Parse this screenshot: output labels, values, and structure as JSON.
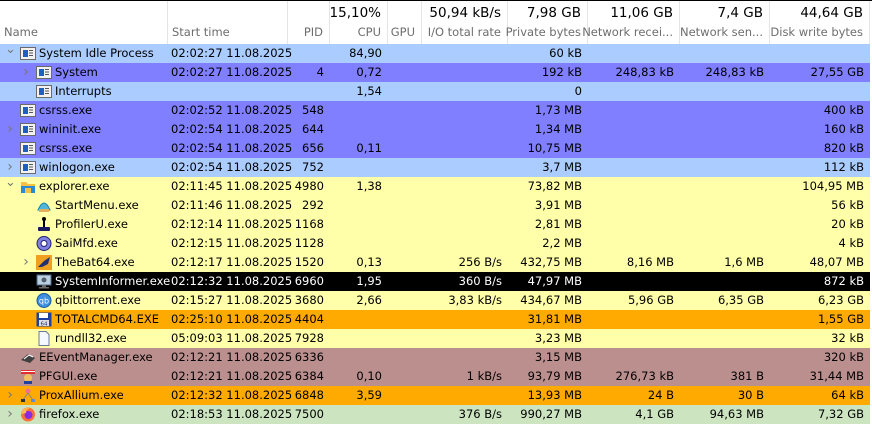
{
  "columns": [
    {
      "key": "name",
      "label": "Name",
      "total": ""
    },
    {
      "key": "start",
      "label": "Start time",
      "total": ""
    },
    {
      "key": "pid",
      "label": "PID",
      "total": ""
    },
    {
      "key": "cpu",
      "label": "CPU",
      "total": "15,10%"
    },
    {
      "key": "gpu",
      "label": "GPU",
      "total": ""
    },
    {
      "key": "io",
      "label": "I/O total rate",
      "total": "50,94 kB/s"
    },
    {
      "key": "priv",
      "label": "Private bytes",
      "total": "7,98 GB"
    },
    {
      "key": "nrecv",
      "label": "Network recei...",
      "total": "11,06 GB"
    },
    {
      "key": "nsent",
      "label": "Network sen...",
      "total": "7,4 GB"
    },
    {
      "key": "dwrite",
      "label": "Disk write bytes",
      "total": "44,64 GB"
    }
  ],
  "colors": {
    "system": "#aaccff",
    "service": "#7f7fff",
    "user": "#ffffaa",
    "elevated": "#ffaa00",
    "other_user": "#bc8f8f",
    "job": "#cce5c0",
    "selected": "#000000"
  },
  "processes": [
    {
      "name": "System Idle Process",
      "icon": "window-icon",
      "level": 0,
      "expander": "expanded",
      "color": "system",
      "start": "02:02:27 11.08.2025",
      "pid": "",
      "cpu": "84,90",
      "gpu": "",
      "io": "",
      "priv": "60 kB",
      "nrecv": "",
      "nsent": "",
      "dwrite": ""
    },
    {
      "name": "System",
      "icon": "window-icon",
      "level": 1,
      "expander": "collapsed",
      "color": "service",
      "start": "02:02:27 11.08.2025",
      "pid": "4",
      "cpu": "0,72",
      "gpu": "",
      "io": "",
      "priv": "192 kB",
      "nrecv": "248,83 kB",
      "nsent": "248,83 kB",
      "dwrite": "27,55 GB"
    },
    {
      "name": "Interrupts",
      "icon": "window-icon",
      "level": 1,
      "expander": "",
      "color": "system",
      "start": "",
      "pid": "",
      "cpu": "1,54",
      "gpu": "",
      "io": "",
      "priv": "0",
      "nrecv": "",
      "nsent": "",
      "dwrite": ""
    },
    {
      "name": "csrss.exe",
      "icon": "window-icon",
      "level": 0,
      "expander": "",
      "color": "service",
      "start": "02:02:52 11.08.2025",
      "pid": "548",
      "cpu": "",
      "gpu": "",
      "io": "",
      "priv": "1,73 MB",
      "nrecv": "",
      "nsent": "",
      "dwrite": "400 kB"
    },
    {
      "name": "wininit.exe",
      "icon": "window-icon",
      "level": 0,
      "expander": "collapsed",
      "color": "service",
      "start": "02:02:54 11.08.2025",
      "pid": "644",
      "cpu": "",
      "gpu": "",
      "io": "",
      "priv": "1,34 MB",
      "nrecv": "",
      "nsent": "",
      "dwrite": "160 kB"
    },
    {
      "name": "csrss.exe",
      "icon": "window-icon",
      "level": 0,
      "expander": "",
      "color": "service",
      "start": "02:02:54 11.08.2025",
      "pid": "656",
      "cpu": "0,11",
      "gpu": "",
      "io": "",
      "priv": "10,75 MB",
      "nrecv": "",
      "nsent": "",
      "dwrite": "820 kB"
    },
    {
      "name": "winlogon.exe",
      "icon": "window-icon",
      "level": 0,
      "expander": "collapsed",
      "color": "system",
      "start": "02:02:54 11.08.2025",
      "pid": "752",
      "cpu": "",
      "gpu": "",
      "io": "",
      "priv": "3,7 MB",
      "nrecv": "",
      "nsent": "",
      "dwrite": "112 kB"
    },
    {
      "name": "explorer.exe",
      "icon": "folder-icon",
      "level": 0,
      "expander": "expanded",
      "color": "user",
      "start": "02:11:45 11.08.2025",
      "pid": "4980",
      "cpu": "1,38",
      "gpu": "",
      "io": "",
      "priv": "73,82 MB",
      "nrecv": "",
      "nsent": "",
      "dwrite": "104,95 MB"
    },
    {
      "name": "StartMenu.exe",
      "icon": "shell-icon",
      "level": 1,
      "expander": "",
      "color": "user",
      "start": "02:11:46 11.08.2025",
      "pid": "292",
      "cpu": "",
      "gpu": "",
      "io": "",
      "priv": "3,91 MB",
      "nrecv": "",
      "nsent": "",
      "dwrite": "56 kB"
    },
    {
      "name": "ProfilerU.exe",
      "icon": "joystick-icon",
      "level": 1,
      "expander": "",
      "color": "user",
      "start": "02:12:14 11.08.2025",
      "pid": "1168",
      "cpu": "",
      "gpu": "",
      "io": "",
      "priv": "2,81 MB",
      "nrecv": "",
      "nsent": "",
      "dwrite": "20 kB"
    },
    {
      "name": "SaiMfd.exe",
      "icon": "gear-icon",
      "level": 1,
      "expander": "",
      "color": "user",
      "start": "02:12:15 11.08.2025",
      "pid": "1128",
      "cpu": "",
      "gpu": "",
      "io": "",
      "priv": "2,2 MB",
      "nrecv": "",
      "nsent": "",
      "dwrite": "4 kB"
    },
    {
      "name": "TheBat64.exe",
      "icon": "bat-icon",
      "level": 1,
      "expander": "collapsed",
      "color": "user",
      "start": "02:12:17 11.08.2025",
      "pid": "1520",
      "cpu": "0,13",
      "gpu": "",
      "io": "256 B/s",
      "priv": "432,75 MB",
      "nrecv": "8,16 MB",
      "nsent": "1,6 MB",
      "dwrite": "48,07 MB"
    },
    {
      "name": "SystemInformer.exe",
      "icon": "monitor-icon",
      "level": 1,
      "expander": "",
      "color": "selected",
      "selected": true,
      "start": "02:12:32 11.08.2025",
      "pid": "6960",
      "cpu": "1,95",
      "gpu": "",
      "io": "360 B/s",
      "priv": "47,97 MB",
      "nrecv": "",
      "nsent": "",
      "dwrite": "872 kB"
    },
    {
      "name": "qbittorrent.exe",
      "icon": "qbittorrent-icon",
      "level": 1,
      "expander": "",
      "color": "user",
      "start": "02:15:27 11.08.2025",
      "pid": "3680",
      "cpu": "2,66",
      "gpu": "",
      "io": "3,83 kB/s",
      "priv": "434,67 MB",
      "nrecv": "5,96 GB",
      "nsent": "6,35 GB",
      "dwrite": "6,23 GB"
    },
    {
      "name": "TOTALCMD64.EXE",
      "icon": "floppy-icon",
      "level": 1,
      "expander": "",
      "color": "elevated",
      "start": "02:25:10 11.08.2025",
      "pid": "4404",
      "cpu": "",
      "gpu": "",
      "io": "",
      "priv": "31,81 MB",
      "nrecv": "",
      "nsent": "",
      "dwrite": "1,55 GB"
    },
    {
      "name": "rundll32.exe",
      "icon": "file-icon",
      "level": 1,
      "expander": "",
      "color": "user",
      "start": "05:09:03 11.08.2025",
      "pid": "7928",
      "cpu": "",
      "gpu": "",
      "io": "",
      "priv": "3,23 MB",
      "nrecv": "",
      "nsent": "",
      "dwrite": "32 kB"
    },
    {
      "name": "EEventManager.exe",
      "icon": "printer-icon",
      "level": 0,
      "expander": "",
      "color": "other_user",
      "start": "02:12:21 11.08.2025",
      "pid": "6336",
      "cpu": "",
      "gpu": "",
      "io": "",
      "priv": "3,15 MB",
      "nrecv": "",
      "nsent": "",
      "dwrite": "320 kB"
    },
    {
      "name": "PFGUI.exe",
      "icon": "police-icon",
      "level": 0,
      "expander": "",
      "color": "other_user",
      "start": "02:12:21 11.08.2025",
      "pid": "6384",
      "cpu": "0,10",
      "gpu": "",
      "io": "1 kB/s",
      "priv": "93,79 MB",
      "nrecv": "276,73 kB",
      "nsent": "381 B",
      "dwrite": "31,44 MB"
    },
    {
      "name": "ProxAllium.exe",
      "icon": "network-icon",
      "level": 0,
      "expander": "collapsed",
      "color": "elevated",
      "start": "02:12:32 11.08.2025",
      "pid": "6848",
      "cpu": "3,59",
      "gpu": "",
      "io": "",
      "priv": "13,93 MB",
      "nrecv": "24 B",
      "nsent": "30 B",
      "dwrite": "64 kB"
    },
    {
      "name": "firefox.exe",
      "icon": "firefox-icon",
      "level": 0,
      "expander": "collapsed",
      "color": "job",
      "start": "02:18:53 11.08.2025",
      "pid": "7500",
      "cpu": "",
      "gpu": "",
      "io": "376 B/s",
      "priv": "990,27 MB",
      "nrecv": "4,1 GB",
      "nsent": "94,63 MB",
      "dwrite": "7,32 GB"
    }
  ]
}
